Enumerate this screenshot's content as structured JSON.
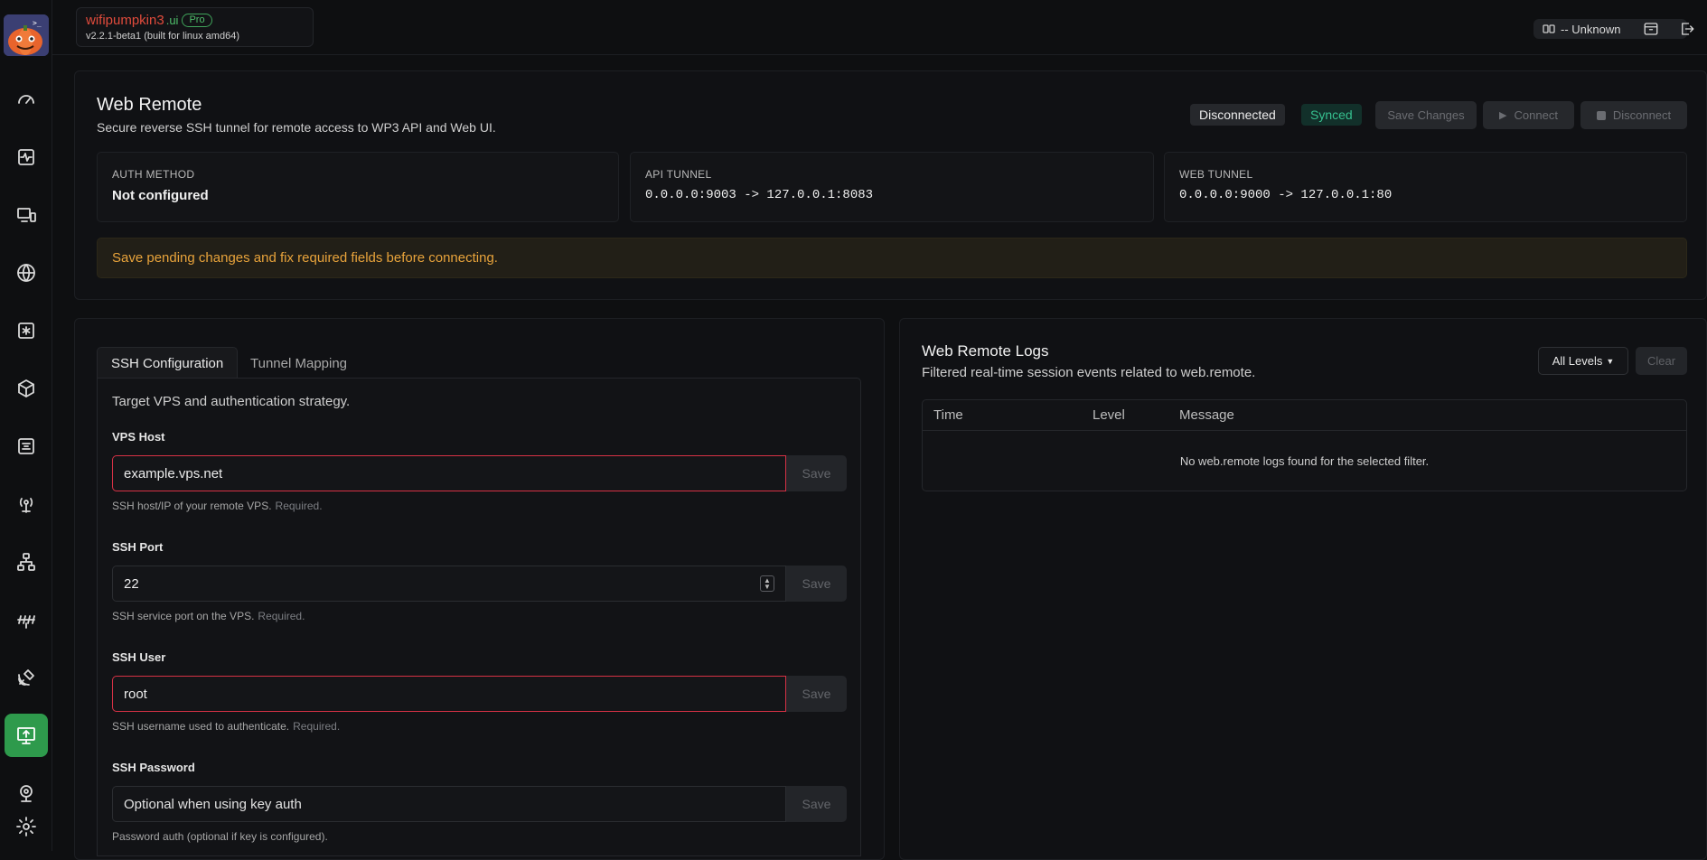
{
  "brand": {
    "name": "wifipumpkin3",
    "suffix": ".ui",
    "badge": "Pro",
    "version": "v2.2.1-beta1 (built for linux amd64)"
  },
  "topbar": {
    "connection_text": "-- Unknown"
  },
  "sidebar": {
    "items": [
      "dashboard-icon",
      "activity-icon",
      "devices-icon",
      "globe-icon",
      "asterisk-icon",
      "package-icon",
      "modules-icon",
      "antenna-icon",
      "network-icon",
      "spectrum-icon",
      "satellite-icon",
      "web-remote-icon",
      "webcam-icon",
      "settings-icon"
    ],
    "active": "web-remote-icon",
    "active_color": "#2e9a4c"
  },
  "header": {
    "title": "Web Remote",
    "subtitle": "Secure reverse SSH tunnel for remote access to WP3 API and Web UI.",
    "status": "Disconnected",
    "sync_status": "Synced",
    "save_label": "Save Changes",
    "connect_label": "Connect",
    "disconnect_label": "Disconnect"
  },
  "info": [
    {
      "label": "AUTH METHOD",
      "value": "Not configured"
    },
    {
      "label": "API TUNNEL",
      "value": "0.0.0.0:9003 -> 127.0.0.1:8083"
    },
    {
      "label": "WEB TUNNEL",
      "value": "0.0.0.0:9000 -> 127.0.0.1:80"
    }
  ],
  "warning": "Save pending changes and fix required fields before connecting.",
  "tabs": {
    "ssh": "SSH Configuration",
    "tunnel": "Tunnel Mapping"
  },
  "form": {
    "description": "Target VPS and authentication strategy.",
    "save": "Save",
    "host": {
      "label": "VPS Host",
      "value": "example.vps.net",
      "help": "SSH host/IP of your remote VPS.",
      "req": "Required."
    },
    "port": {
      "label": "SSH Port",
      "value": "22",
      "help": "SSH service port on the VPS.",
      "req": "Required."
    },
    "user": {
      "label": "SSH User",
      "value": "root",
      "help": "SSH username used to authenticate.",
      "req": "Required."
    },
    "password": {
      "label": "SSH Password",
      "placeholder": "Optional when using key auth",
      "help": "Password auth (optional if key is configured)."
    }
  },
  "logs": {
    "title": "Web Remote Logs",
    "subtitle": "Filtered real-time session events related to web.remote.",
    "filter": "All Levels",
    "clear": "Clear",
    "columns": [
      "Time",
      "Level",
      "Message"
    ],
    "empty": "No web.remote logs found for the selected filter."
  },
  "colors": {
    "accent": "#2e9a4c",
    "error_border": "#d63145",
    "warning": "#e8a33b",
    "synced": "#36c08f"
  }
}
